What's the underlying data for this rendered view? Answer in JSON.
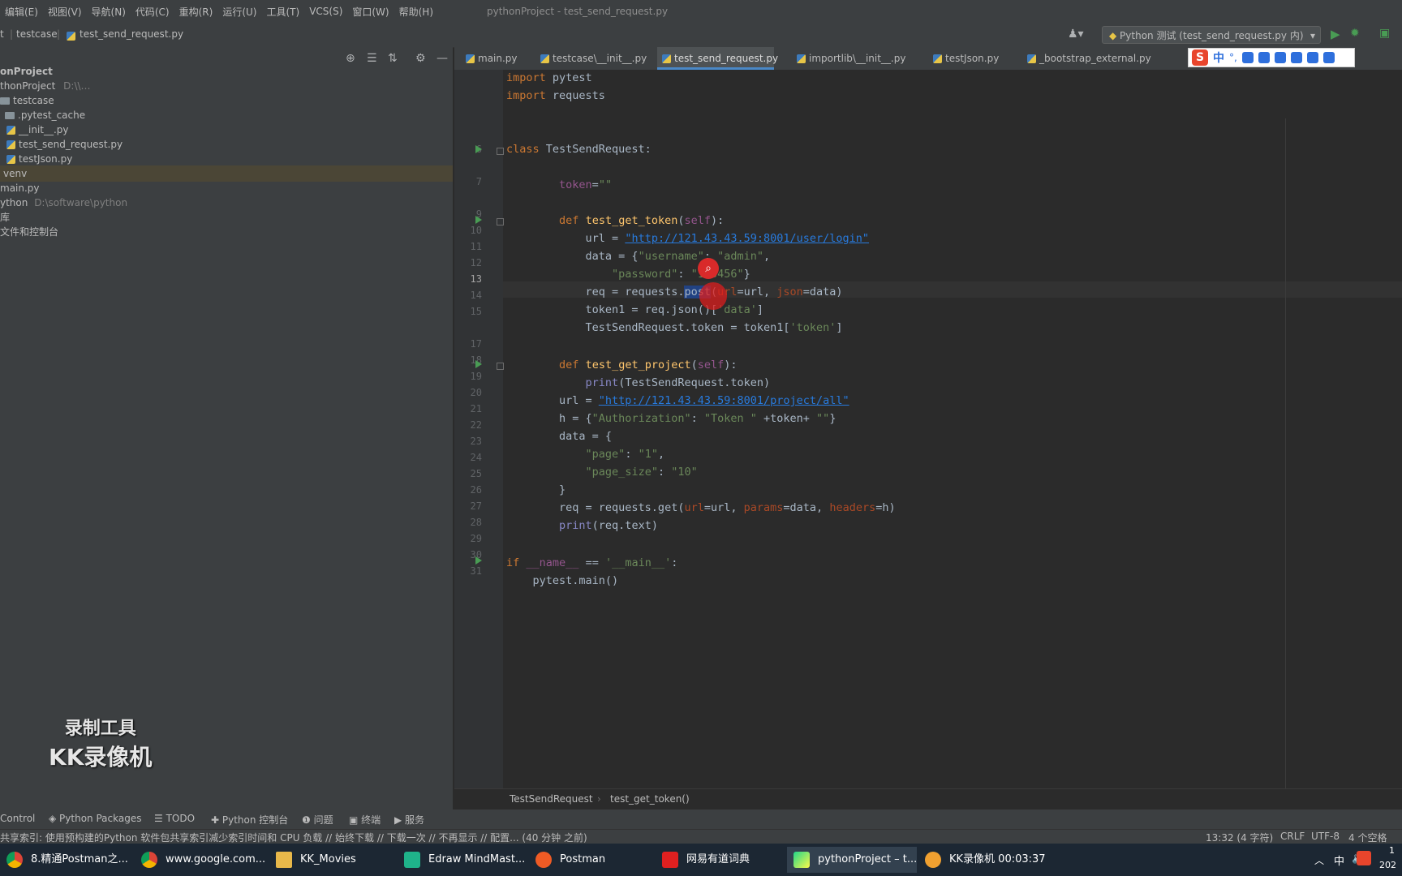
{
  "menu": {
    "items": [
      "编辑(E)",
      "视图(V)",
      "导航(N)",
      "代码(C)",
      "重构(R)",
      "运行(U)",
      "工具(T)",
      "VCS(S)",
      "窗口(W)",
      "帮助(H)"
    ],
    "window_title": "pythonProject - test_send_request.py"
  },
  "navbar": {
    "crumbs": [
      "t",
      "testcase",
      "test_send_request.py"
    ],
    "run_config": "Python 测试 (test_send_request.py 内)"
  },
  "project": {
    "root": "onProject",
    "rows": [
      {
        "label": "thonProject",
        "suffix": "D:\\\\…"
      },
      {
        "label": "testcase",
        "suffix": ""
      },
      {
        "label": ".pytest_cache",
        "suffix": ""
      },
      {
        "label": "__init__.py",
        "suffix": ""
      },
      {
        "label": "test_send_request.py",
        "suffix": ""
      },
      {
        "label": "testJson.py",
        "suffix": ""
      },
      {
        "label": "venv",
        "suffix": ""
      },
      {
        "label": "main.py",
        "suffix": ""
      },
      {
        "label": "ython",
        "suffix": "D:\\software\\python"
      },
      {
        "label": "库",
        "suffix": ""
      },
      {
        "label": "文件和控制台",
        "suffix": ""
      }
    ]
  },
  "tabs": [
    "main.py",
    "testcase\\__init__.py",
    "test_send_request.py",
    "importlib\\__init__.py",
    "testJson.py",
    "_bootstrap_external.py"
  ],
  "ime": {
    "cn": "中",
    "punct": "°,"
  },
  "editor": {
    "line_numbers": [
      "",
      "",
      "",
      "",
      "6",
      "",
      "7",
      "",
      "9",
      "10",
      "11",
      "12",
      "13",
      "14",
      "15",
      "",
      "17",
      "18",
      "19",
      "20",
      "21",
      "22",
      "23",
      "24",
      "25",
      "26",
      "27",
      "28",
      "29",
      "30",
      "31"
    ],
    "code_breadcrumb": [
      "TestSendRequest",
      "test_get_token()"
    ]
  },
  "toolwindows": [
    "Control",
    "Python Packages",
    "TODO",
    "Python 控制台",
    "问题",
    "终端",
    "服务"
  ],
  "status": {
    "message": "共享索引: 使用预构建的Python 软件包共享索引减少索引时间和 CPU 负载 // 始终下载 // 下载一次 // 不再显示 // 配置... (40 分钟 之前)",
    "position": "13:32 (4 字符)",
    "line_sep": "CRLF",
    "encoding": "UTF-8",
    "indent": "4 个空格"
  },
  "taskbar": {
    "items": [
      "8.精通Postman之...",
      "www.google.com...",
      "KK_Movies",
      "Edraw MindMast...",
      "Postman",
      "网易有道词典",
      "pythonProject – t...",
      "KK录像机 00:03:37"
    ],
    "tray_lang": "中",
    "clock_top": "1",
    "clock_bottom": "202"
  },
  "watermark": {
    "line1": "录制工具",
    "line2": "KK录像机"
  }
}
